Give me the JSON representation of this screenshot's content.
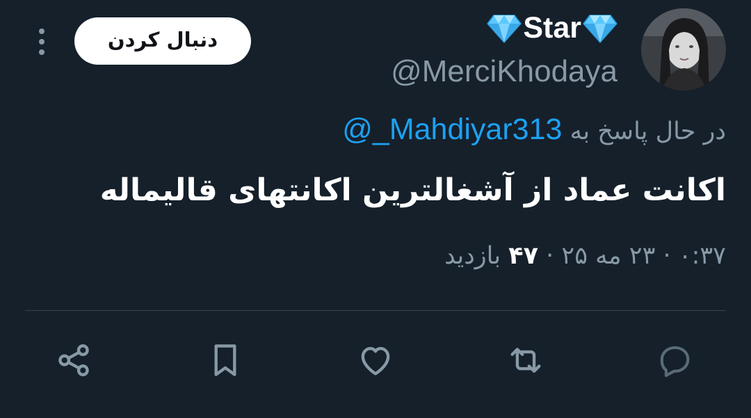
{
  "header": {
    "name_text": "Star",
    "handle": "@MerciKhodaya",
    "follow_label": "دنبال کردن"
  },
  "reply": {
    "prefix": "در حال پاسخ به",
    "mention": "@_Mahdiyar313"
  },
  "tweet": {
    "text": "اکانت عماد از آشغالترین اکانتهای قالیماله"
  },
  "meta": {
    "time": "۰:۳۷",
    "separator": "·",
    "date": "۲۳ مه ۲۵",
    "views_count": "۴۷",
    "views_label": "بازدید"
  },
  "actions": {
    "icons": [
      "reply-icon",
      "retweet-icon",
      "like-icon",
      "bookmark-icon",
      "share-icon"
    ]
  },
  "colors": {
    "background": "#15202b",
    "secondary_text": "#8899a6",
    "link": "#1da1f2",
    "divider": "#38444d",
    "gem": "#5bc8ff"
  }
}
